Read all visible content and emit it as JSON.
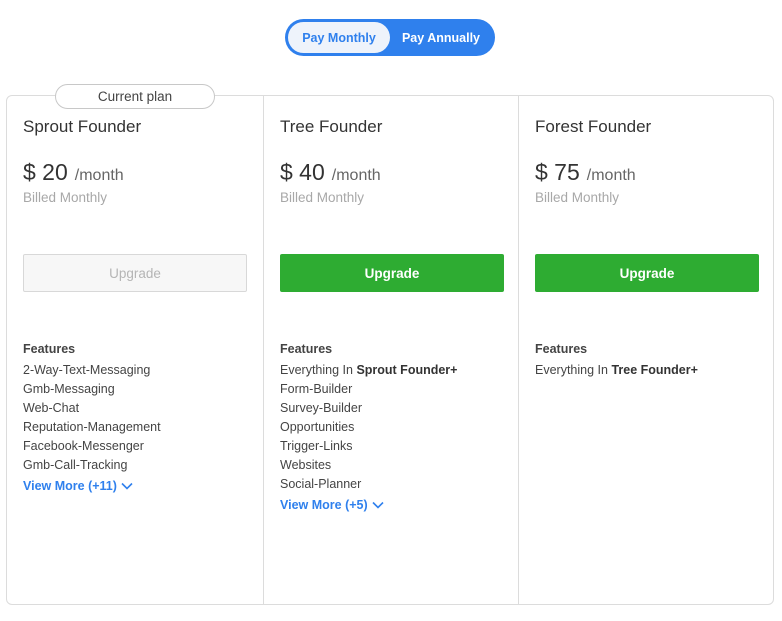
{
  "billing_toggle": {
    "monthly_label": "Pay Monthly",
    "annually_label": "Pay Annually",
    "selected": "Pay Monthly"
  },
  "current_plan_badge": "Current plan",
  "features_label": "Features",
  "plans": [
    {
      "name": "Sprout Founder",
      "price": "$ 20",
      "period": "/month",
      "billed": "Billed Monthly",
      "upgrade_label": "Upgrade",
      "upgrade_enabled": false,
      "is_current": true,
      "features": [
        "2-Way-Text-Messaging",
        "Gmb-Messaging",
        "Web-Chat",
        "Reputation-Management",
        "Facebook-Messenger",
        "Gmb-Call-Tracking"
      ],
      "view_more": "View More (+11)"
    },
    {
      "name": "Tree Founder",
      "price": "$ 40",
      "period": "/month",
      "billed": "Billed Monthly",
      "upgrade_label": "Upgrade",
      "upgrade_enabled": true,
      "everything_prefix": "Everything In ",
      "everything_plan": "Sprout Founder+",
      "features": [
        "Form-Builder",
        "Survey-Builder",
        "Opportunities",
        "Trigger-Links",
        "Websites",
        "Social-Planner"
      ],
      "view_more": "View More (+5)"
    },
    {
      "name": "Forest Founder",
      "price": "$ 75",
      "period": "/month",
      "billed": "Billed Monthly",
      "upgrade_label": "Upgrade",
      "upgrade_enabled": true,
      "everything_prefix": "Everything In ",
      "everything_plan": "Tree Founder+",
      "features": []
    }
  ],
  "colors": {
    "accent_blue": "#2f80ed",
    "upgrade_green": "#2eac32"
  }
}
